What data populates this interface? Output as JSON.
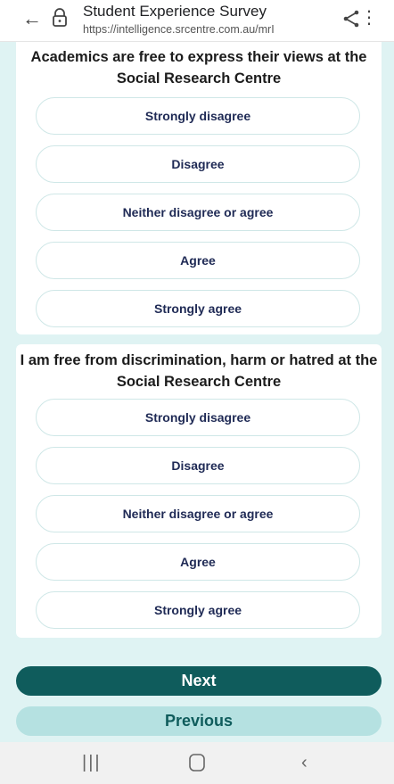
{
  "browser": {
    "title": "Student Experience Survey",
    "url": "https://intelligence.srcentre.com.au/mrI"
  },
  "questions": [
    {
      "text": "Academics are free to express their views at the Social Research Centre",
      "options": [
        "Strongly disagree",
        "Disagree",
        "Neither disagree or agree",
        "Agree",
        "Strongly agree"
      ]
    },
    {
      "text": "I am free from discrimination, harm or hatred at the Social Research Centre",
      "options": [
        "Strongly disagree",
        "Disagree",
        "Neither disagree or agree",
        "Agree",
        "Strongly agree"
      ]
    }
  ],
  "buttons": {
    "next": "Next",
    "previous": "Previous"
  },
  "colors": {
    "background": "#dff3f3",
    "primary": "#0f5c5c",
    "secondary": "#b5e1e1",
    "option_text": "#1f2a55"
  },
  "icons": {
    "back": "back-arrow-icon",
    "lock": "lock-icon",
    "share": "share-icon",
    "more": "more-vert-icon",
    "recents": "recents-icon",
    "home": "home-icon",
    "nav_back": "nav-back-icon"
  }
}
